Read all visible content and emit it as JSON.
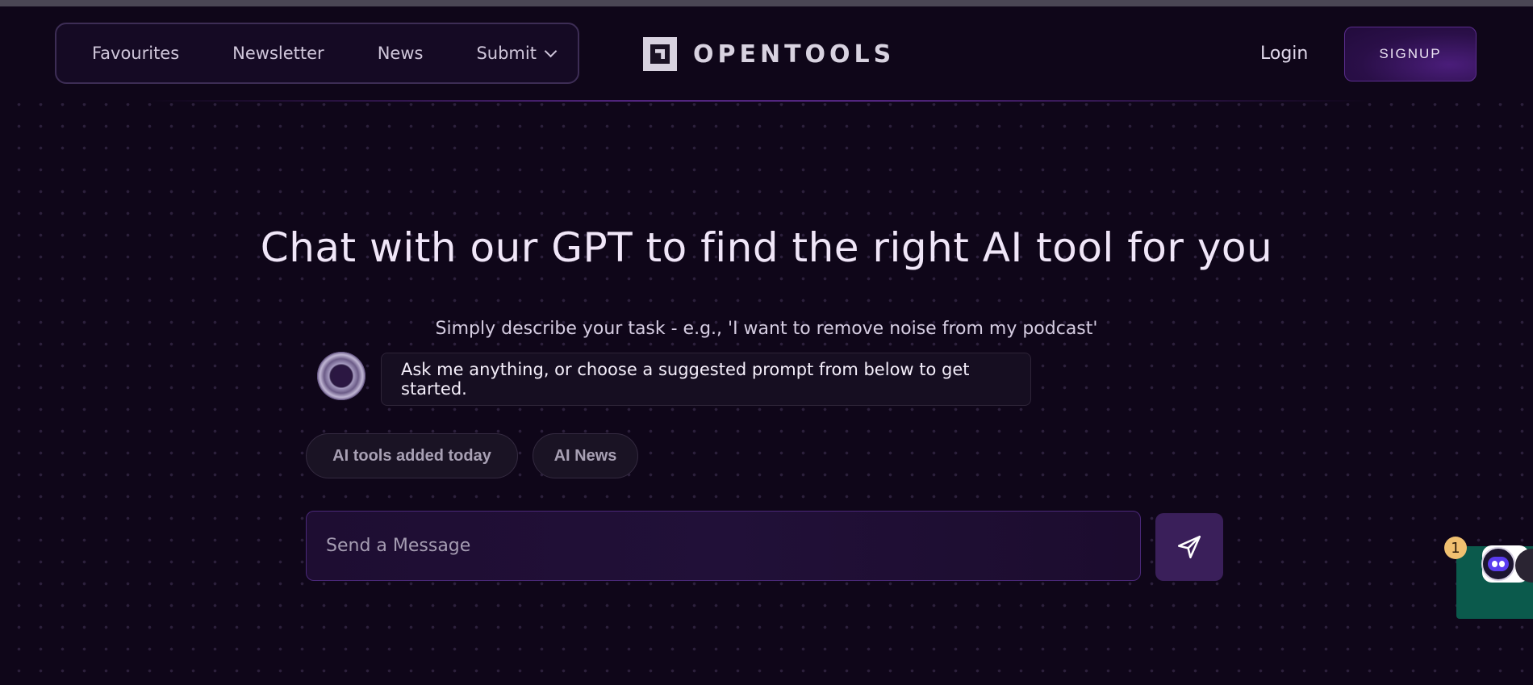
{
  "nav": {
    "items": [
      {
        "label": "Favourites"
      },
      {
        "label": "Newsletter"
      },
      {
        "label": "News"
      },
      {
        "label": "Submit",
        "has_dropdown": true
      }
    ]
  },
  "brand": {
    "logo_text": "OPENTOOLS",
    "logo_icon": "opentools-logo-icon"
  },
  "auth": {
    "login_label": "Login",
    "signup_label": "SIGNUP"
  },
  "hero": {
    "headline": "Chat with our GPT to find the right AI tool for you",
    "subtitle": "Simply describe your task - e.g., 'I want to remove noise from my podcast'"
  },
  "chat": {
    "bot_message": "Ask me anything, or choose a suggested prompt from below to get started.",
    "suggestions": [
      {
        "label": "AI tools added today"
      },
      {
        "label": "AI News"
      }
    ],
    "input": {
      "placeholder": "Send a Message",
      "value": ""
    },
    "send_icon": "send-icon"
  },
  "widget": {
    "badge_count": "1",
    "icon": "chat-widget-icon"
  },
  "colors": {
    "background": "#0f0619",
    "accent": "#5b2d8e",
    "widget": "#0b5a4c",
    "badge": "#f0c070"
  }
}
